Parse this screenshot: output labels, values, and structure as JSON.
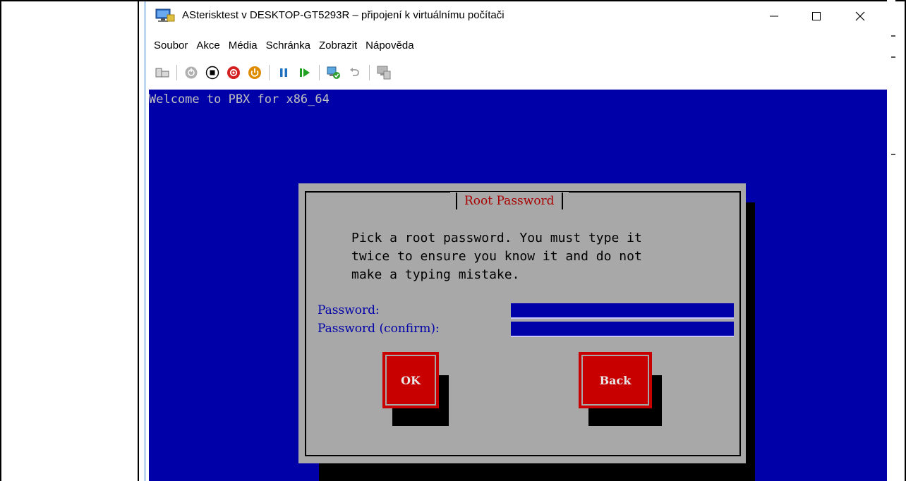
{
  "window": {
    "title": "ASterisktest v DESKTOP-GT5293R – připojení k virtuálnímu počítači",
    "app_icon": "vm-connection-icon",
    "controls": [
      "minimize-icon",
      "maximize-icon",
      "close-icon"
    ]
  },
  "menu": {
    "items": [
      "Soubor",
      "Akce",
      "Média",
      "Schránka",
      "Zobrazit",
      "Nápověda"
    ]
  },
  "toolbar": {
    "buttons": [
      {
        "icon": "ctrl-alt-del-icon"
      },
      {
        "icon": "start-icon-disabled"
      },
      {
        "icon": "turn-off-icon"
      },
      {
        "icon": "shut-down-icon"
      },
      {
        "icon": "save-icon"
      },
      {
        "icon": "pause-icon"
      },
      {
        "icon": "resume-icon"
      },
      {
        "icon": "checkpoint-icon"
      },
      {
        "icon": "revert-icon"
      },
      {
        "icon": "enhanced-session-icon"
      }
    ],
    "colors": {
      "red": "#d32020",
      "orange": "#e08a00",
      "blue": "#2070c0",
      "green": "#20a020",
      "gray": "#9a9a9a"
    }
  },
  "console": {
    "welcome_line": "Welcome to PBX for x86_64"
  },
  "dialog": {
    "title": "Root Password",
    "message_lines": [
      "Pick a root password. You must type it",
      "twice to ensure you know it and do not",
      "make a typing mistake."
    ],
    "password_label": "Password:",
    "password_value": "",
    "confirm_label": "Password (confirm):",
    "confirm_value": "",
    "ok_label": "OK",
    "back_label": "Back"
  },
  "colors": {
    "screen_bg": "#0000a8",
    "dialog_bg": "#a8a8a8",
    "title_fg": "#a80000",
    "label_fg": "#0000a8",
    "button_bg": "#c80000",
    "console_fg": "#c0c0c0"
  }
}
